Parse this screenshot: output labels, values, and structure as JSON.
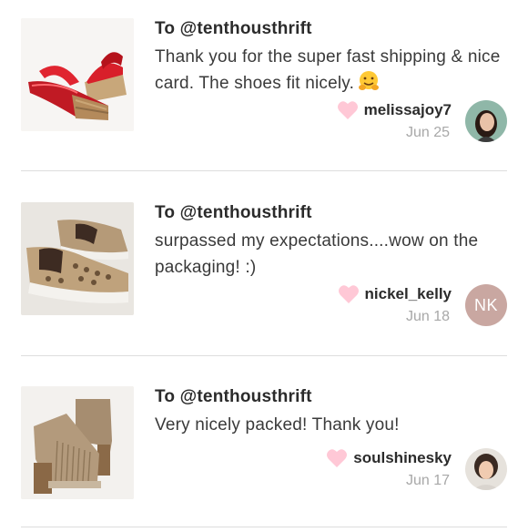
{
  "reviews": [
    {
      "to": "To @tenthousthrift",
      "message": "Thank you for the super fast shipping & nice card. The shoes fit nicely.",
      "emoji": "hugging-face-emoji",
      "username": "melissajoy7",
      "date": "Jun 25",
      "avatar": "photo"
    },
    {
      "to": "To @tenthousthrift",
      "message": "surpassed my expectations....wow on the packaging! :)",
      "username": "nickel_kelly",
      "date": "Jun 18",
      "avatar_initials": "NK"
    },
    {
      "to": "To @tenthousthrift",
      "message": "Very nicely packed! Thank you!",
      "username": "soulshinesky",
      "date": "Jun 17",
      "avatar": "photo"
    }
  ],
  "colors": {
    "heart": "#ffc8d6",
    "date": "#a8a8a8",
    "divider": "#dddddd",
    "initials_avatar": "#c9a7a1"
  }
}
